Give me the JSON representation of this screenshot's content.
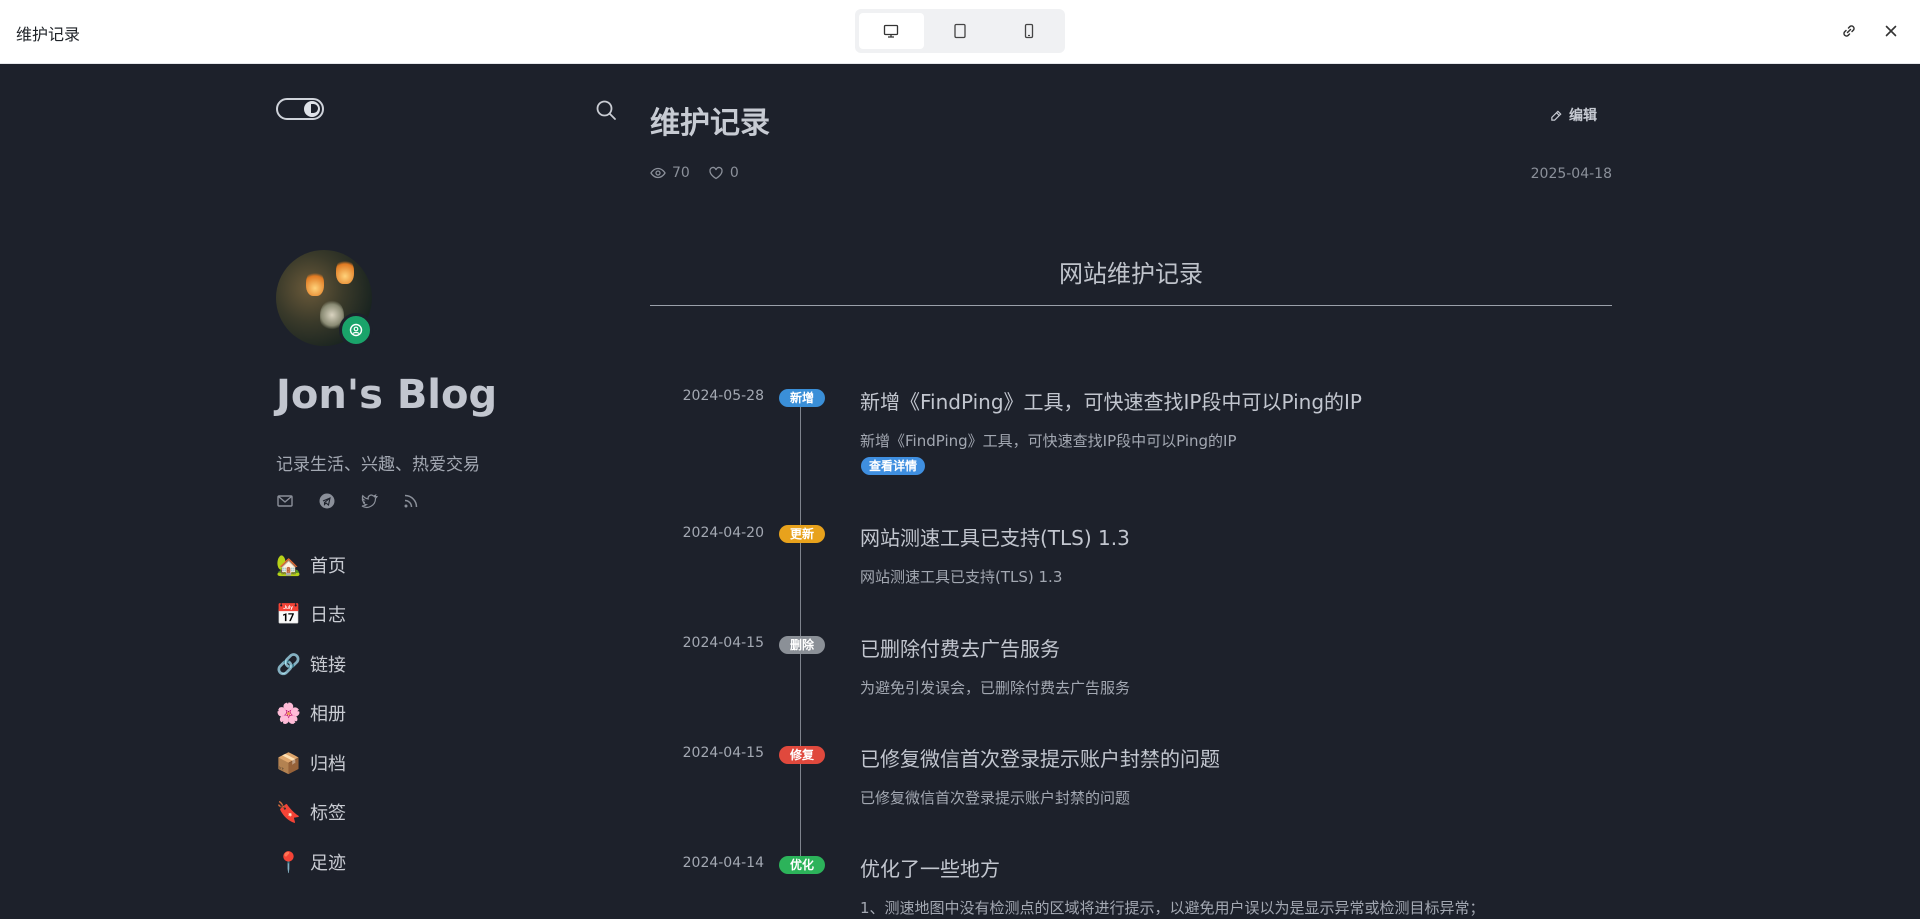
{
  "window": {
    "title": "维护记录"
  },
  "sidebar": {
    "blog_name": "Jon's Blog",
    "slogan": "记录生活、兴趣、热爱交易",
    "nav": [
      {
        "label": "首页",
        "icon": "home-icon",
        "glyph": "🏡"
      },
      {
        "label": "日志",
        "icon": "journal-icon",
        "glyph": "📅"
      },
      {
        "label": "链接",
        "icon": "link-icon",
        "glyph": "🔗"
      },
      {
        "label": "相册",
        "icon": "album-icon",
        "glyph": "🌸"
      },
      {
        "label": "归档",
        "icon": "archive-icon",
        "glyph": "📦"
      },
      {
        "label": "标签",
        "icon": "bookmark-icon",
        "glyph": "🔖"
      },
      {
        "label": "足迹",
        "icon": "map-pin-icon",
        "glyph": "📍"
      }
    ]
  },
  "post": {
    "title": "维护记录",
    "edit_label": "编辑",
    "views": "70",
    "likes": "0",
    "date": "2025-04-18",
    "section_title": "网站维护记录"
  },
  "timeline": [
    {
      "date": "2024-05-28",
      "badge": "新增",
      "badge_color": "#3a8fd8",
      "title": "新增《FindPing》工具，可快速查找IP段中可以Ping的IP",
      "desc": "新增《FindPing》工具，可快速查找IP段中可以Ping的IP",
      "link": "查看详情"
    },
    {
      "date": "2024-04-20",
      "badge": "更新",
      "badge_color": "#e8a21c",
      "title": "网站测速工具已支持(TLS) 1.3",
      "desc": "网站测速工具已支持(TLS) 1.3"
    },
    {
      "date": "2024-04-15",
      "badge": "删除",
      "badge_color": "#8b9097",
      "title": "已删除付费去广告服务",
      "desc": "为避免引发误会，已删除付费去广告服务"
    },
    {
      "date": "2024-04-15",
      "badge": "修复",
      "badge_color": "#e0493d",
      "title": "已修复微信首次登录提示账户封禁的问题",
      "desc": "已修复微信首次登录提示账户封禁的问题"
    },
    {
      "date": "2024-04-14",
      "badge": "优化",
      "badge_color": "#2cb35a",
      "title": "优化了一些地方",
      "desc": "1、测速地图中没有检测点的区域将进行提示，以避免用户误以为是显示异常或检测目标异常；"
    }
  ]
}
